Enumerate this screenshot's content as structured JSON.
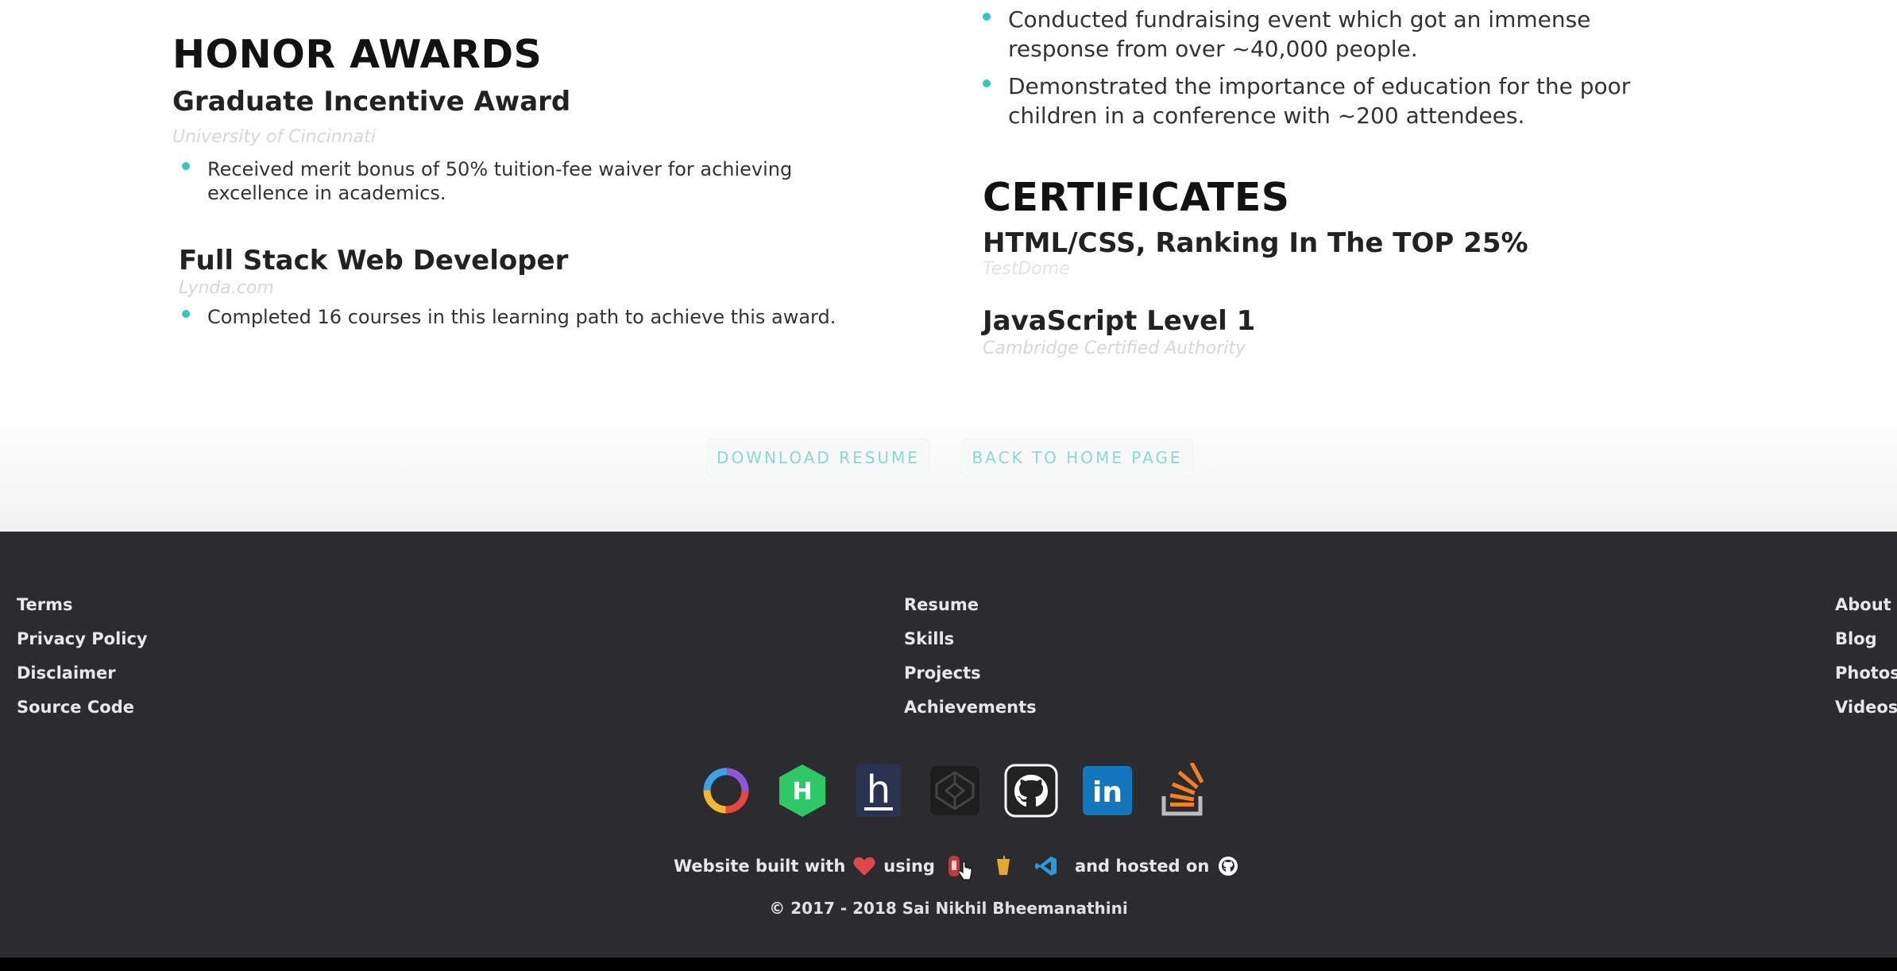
{
  "honor_awards": {
    "heading": "HONOR AWARDS",
    "items": [
      {
        "title": "Graduate Incentive Award",
        "org": "University of Cincinnati",
        "bullets": [
          "Received merit bonus of 50% tuition-fee waiver for achieving",
          "excellence in academics."
        ]
      },
      {
        "title": "Full Stack Web Developer",
        "org": "Lynda.com",
        "bullets": [
          "Completed 16 courses in this learning path to achieve this award."
        ]
      }
    ]
  },
  "activities": {
    "bullets": [
      [
        "Conducted fundraising event which got an immense",
        "response from over ~40,000 people."
      ],
      [
        "Demonstrated the importance of education for the poor",
        "children in a conference with ~200 attendees."
      ]
    ]
  },
  "certificates": {
    "heading": "CERTIFICATES",
    "items": [
      {
        "title": "HTML/CSS, Ranking In The TOP 25%",
        "org": "TestDome"
      },
      {
        "title": "JavaScript Level 1",
        "org": "Cambridge Certified Authority"
      }
    ]
  },
  "buttons": {
    "download_resume": "DOWNLOAD RESUME",
    "back_home": "BACK TO HOME PAGE"
  },
  "footer": {
    "col1": [
      "Terms",
      "Privacy Policy",
      "Disclaimer",
      "Source Code"
    ],
    "col2": [
      "Resume",
      "Skills",
      "Projects",
      "Achievements"
    ],
    "col3": [
      "About",
      "Blog",
      "Photos",
      "Videos"
    ],
    "social_icons": [
      "hackerearth-icon",
      "hackerrank-icon",
      "hashnode-icon",
      "codepen-icon",
      "github-icon",
      "linkedin-icon",
      "stackoverflow-icon"
    ],
    "built_with": {
      "prefix": "Website built with",
      "using": "using",
      "hosted": "and hosted on"
    },
    "copyright": "© 2017 - 2018 Sai Nikhil Bheemanathini"
  },
  "colors": {
    "accent": "#35c6c0",
    "footer_bg": "#2c2c2e",
    "heart": "#e0474c"
  }
}
